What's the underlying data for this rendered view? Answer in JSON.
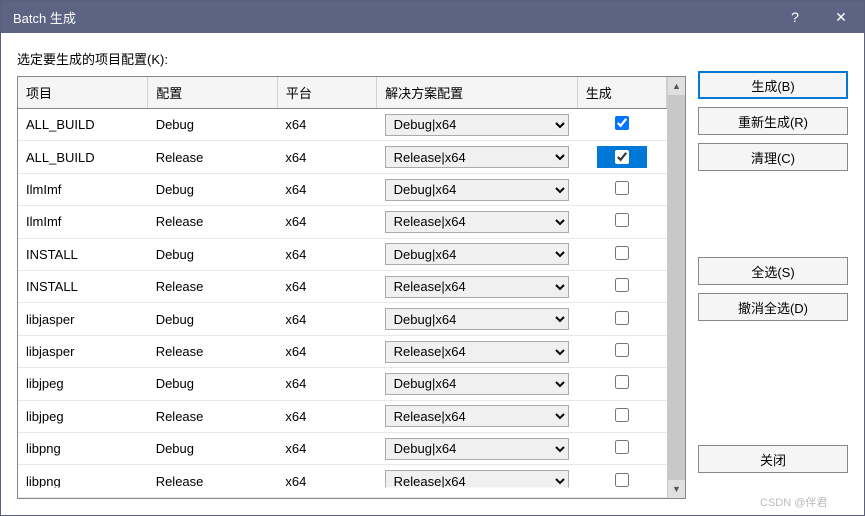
{
  "titlebar": {
    "title": "Batch 生成",
    "help": "?",
    "close": "✕"
  },
  "label": "选定要生成的项目配置(K):",
  "headers": {
    "project": "项目",
    "config": "配置",
    "platform": "平台",
    "solution": "解决方案配置",
    "build": "生成"
  },
  "rows": [
    {
      "project": "ALL_BUILD",
      "config": "Debug",
      "platform": "x64",
      "solution": "Debug|x64",
      "checked": true,
      "highlight": false
    },
    {
      "project": "ALL_BUILD",
      "config": "Release",
      "platform": "x64",
      "solution": "Release|x64",
      "checked": true,
      "highlight": true
    },
    {
      "project": "IlmImf",
      "config": "Debug",
      "platform": "x64",
      "solution": "Debug|x64",
      "checked": false,
      "highlight": false
    },
    {
      "project": "IlmImf",
      "config": "Release",
      "platform": "x64",
      "solution": "Release|x64",
      "checked": false,
      "highlight": false
    },
    {
      "project": "INSTALL",
      "config": "Debug",
      "platform": "x64",
      "solution": "Debug|x64",
      "checked": false,
      "highlight": false
    },
    {
      "project": "INSTALL",
      "config": "Release",
      "platform": "x64",
      "solution": "Release|x64",
      "checked": false,
      "highlight": false
    },
    {
      "project": "libjasper",
      "config": "Debug",
      "platform": "x64",
      "solution": "Debug|x64",
      "checked": false,
      "highlight": false
    },
    {
      "project": "libjasper",
      "config": "Release",
      "platform": "x64",
      "solution": "Release|x64",
      "checked": false,
      "highlight": false
    },
    {
      "project": "libjpeg",
      "config": "Debug",
      "platform": "x64",
      "solution": "Debug|x64",
      "checked": false,
      "highlight": false
    },
    {
      "project": "libjpeg",
      "config": "Release",
      "platform": "x64",
      "solution": "Release|x64",
      "checked": false,
      "highlight": false
    },
    {
      "project": "libpng",
      "config": "Debug",
      "platform": "x64",
      "solution": "Debug|x64",
      "checked": false,
      "highlight": false
    },
    {
      "project": "libpng",
      "config": "Release",
      "platform": "x64",
      "solution": "Release|x64",
      "checked": false,
      "highlight": false
    }
  ],
  "buttons": {
    "build": "生成(B)",
    "rebuild": "重新生成(R)",
    "clean": "清理(C)",
    "selectAll": "全选(S)",
    "deselectAll": "撤消全选(D)",
    "close": "关闭"
  },
  "watermark": "CSDN @伴君"
}
